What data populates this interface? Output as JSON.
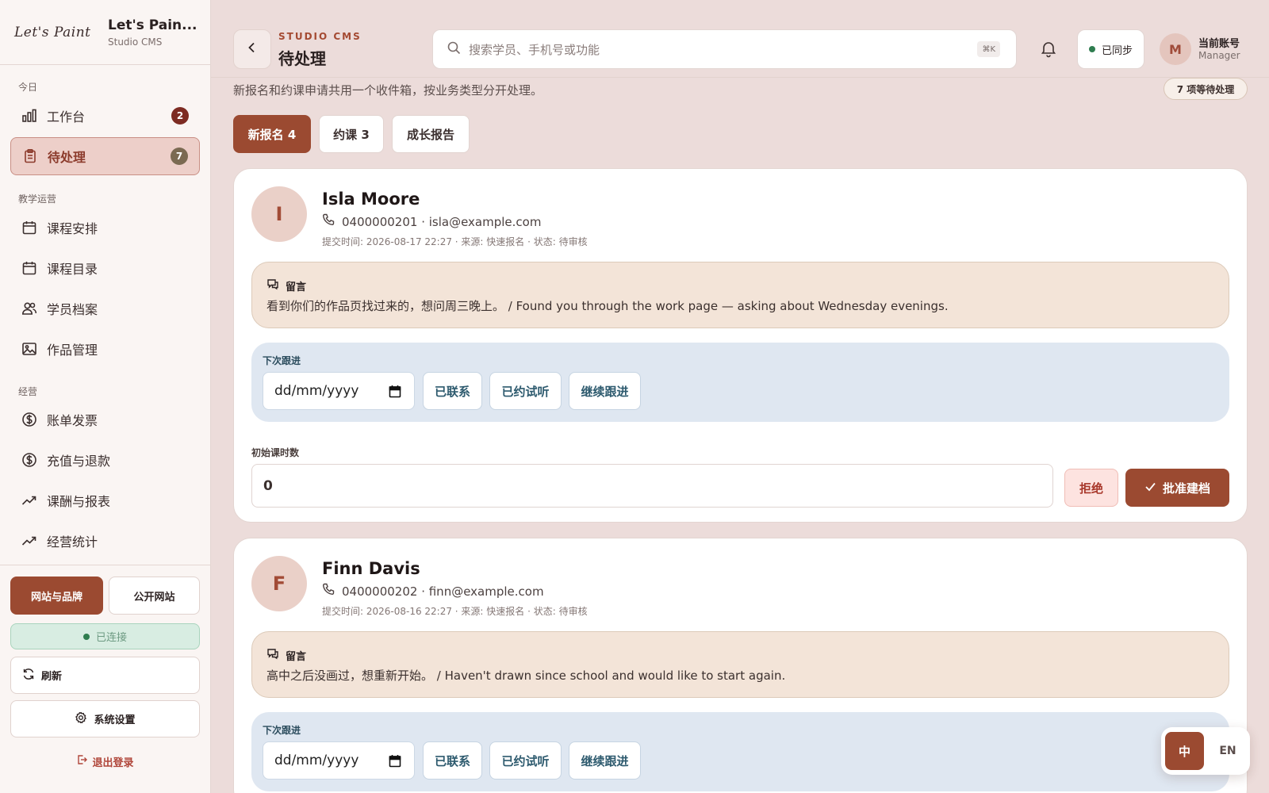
{
  "brand": {
    "script": "Let's Paint",
    "name": "Let's Pain...",
    "subtitle": "Studio CMS"
  },
  "sidebar": {
    "sections": {
      "today": "今日",
      "teaching": "教学运营",
      "business": "经营"
    },
    "items": [
      {
        "label": "工作台",
        "badge": "2",
        "icon": "bar-chart-icon"
      },
      {
        "label": "待处理",
        "badge": "7",
        "icon": "clipboard-icon",
        "active": true
      },
      {
        "label": "课程安排",
        "icon": "calendar-icon"
      },
      {
        "label": "课程目录",
        "icon": "calendar-icon"
      },
      {
        "label": "学员档案",
        "icon": "users-icon"
      },
      {
        "label": "作品管理",
        "icon": "image-icon"
      },
      {
        "label": "账单发票",
        "icon": "dollar-circle-icon"
      },
      {
        "label": "充值与退款",
        "icon": "dollar-circle-icon"
      },
      {
        "label": "课酬与报表",
        "icon": "trending-up-icon"
      },
      {
        "label": "经营统计",
        "icon": "trending-up-icon"
      }
    ],
    "brand_button": "网站与品牌",
    "public_button": "公开网站",
    "connected": "已连接",
    "refresh": "刷新",
    "settings": "系统设置",
    "logout": "退出登录"
  },
  "header": {
    "eyebrow": "STUDIO CMS",
    "title": "待处理",
    "search_placeholder": "搜索学员、手机号或功能",
    "shortcut": "⌘K",
    "synced": "已同步",
    "account_initial": "M",
    "account_name": "当前账号",
    "account_role": "Manager"
  },
  "page": {
    "subtitle": "新报名和约课申请共用一个收件箱，按业务类型分开处理。",
    "pending_pill": "7 项等待处理",
    "tabs": [
      {
        "label": "新报名 4",
        "active": true
      },
      {
        "label": "约课 3"
      },
      {
        "label": "成长报告"
      }
    ]
  },
  "cards": [
    {
      "initial": "I",
      "name": "Isla Moore",
      "contact": "0400000201 · isla@example.com",
      "meta": "提交时间: 2026-08-17 22:27 · 来源: 快速报名 · 状态: 待审核",
      "note_label": "留言",
      "note": "看到你们的作品页找过来的，想问周三晚上。 / Found you through the work page — asking about Wednesday evenings.",
      "follow_label": "下次跟进",
      "date_placeholder": "dd/mm/yyyy",
      "actions": [
        "已联系",
        "已约试听",
        "继续跟进"
      ],
      "hours_label": "初始课时数",
      "hours_value": "0",
      "reject": "拒绝",
      "approve": "批准建档"
    },
    {
      "initial": "F",
      "name": "Finn Davis",
      "contact": "0400000202 · finn@example.com",
      "meta": "提交时间: 2026-08-16 22:27 · 来源: 快速报名 · 状态: 待审核",
      "note_label": "留言",
      "note": "高中之后没画过，想重新开始。 / Haven't drawn since school and would like to start again.",
      "follow_label": "下次跟进",
      "date_placeholder": "dd/mm/yyyy",
      "actions": [
        "已联系",
        "已约试听",
        "继续跟进"
      ]
    }
  ],
  "lang": {
    "zh": "中",
    "en": "EN"
  },
  "colors": {
    "accent": "#9b4a31",
    "active_nav_bg": "#edcfc9",
    "note_bg": "#f3e4d8",
    "followup_bg": "#dfe7f1",
    "connected_bg": "#d8ede2"
  }
}
